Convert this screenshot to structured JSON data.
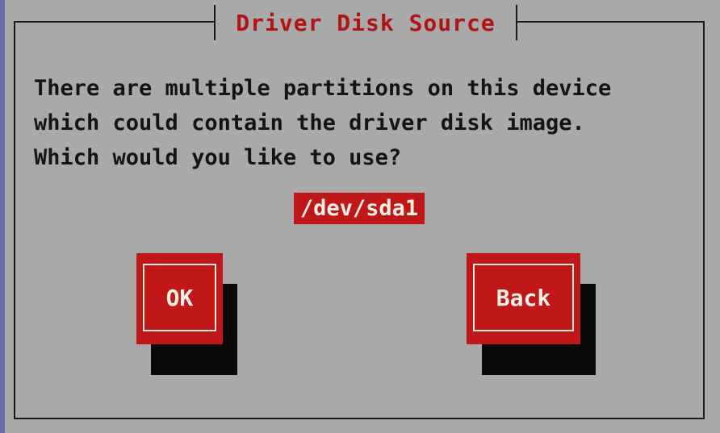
{
  "dialog": {
    "title": "Driver Disk Source",
    "message_lines": [
      "There are multiple partitions on this device",
      "which could contain the driver disk image.",
      "Which would you like to use?"
    ]
  },
  "partition_list": {
    "selected": "/dev/sda1"
  },
  "buttons": {
    "ok_label": "OK",
    "back_label": "Back"
  },
  "colors": {
    "background": "#a9a9a9",
    "accent_red": "#c01818",
    "title_red": "#b01414",
    "text": "#141414",
    "button_text": "#f4f0e6",
    "shadow": "#0a0a0a"
  }
}
